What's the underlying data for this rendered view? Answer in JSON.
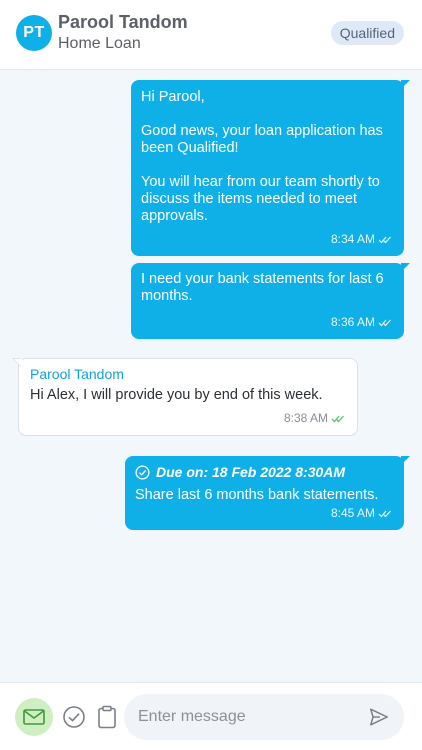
{
  "header": {
    "avatar_initials": "PT",
    "contact_name": "Parool Tandom",
    "subtitle": "Home Loan",
    "status": "Qualified"
  },
  "messages": [
    {
      "direction": "outgoing",
      "text": "Hi Parool,\n\nGood news, your loan application has been Qualified!\n\nYou will hear from our team shortly to discuss the items needed to meet approvals.",
      "time": "8:34 AM",
      "read_status": "double-check-icon"
    },
    {
      "direction": "outgoing",
      "text": "I need your bank statements for last 6 months.",
      "time": "8:36 AM",
      "read_status": "double-check-icon"
    },
    {
      "direction": "incoming",
      "sender": "Parool Tandom",
      "text": "Hi Alex, I will provide you by end of this week.",
      "time": "8:38 AM",
      "read_status": "double-check-icon"
    },
    {
      "direction": "outgoing",
      "task_title": "Due on: 18 Feb 2022 8:30AM",
      "text": "Share last 6 months bank statements.",
      "time": "8:45 AM",
      "read_status": "double-check-icon"
    }
  ],
  "composer": {
    "placeholder": "Enter message",
    "value": ""
  },
  "colors": {
    "accent": "#0fb0e7",
    "background": "#f2f7fc",
    "badge_bg": "#dfe8f6",
    "mail_button_bg": "#cfeec2",
    "read_check_incoming": "#5cc36b"
  }
}
